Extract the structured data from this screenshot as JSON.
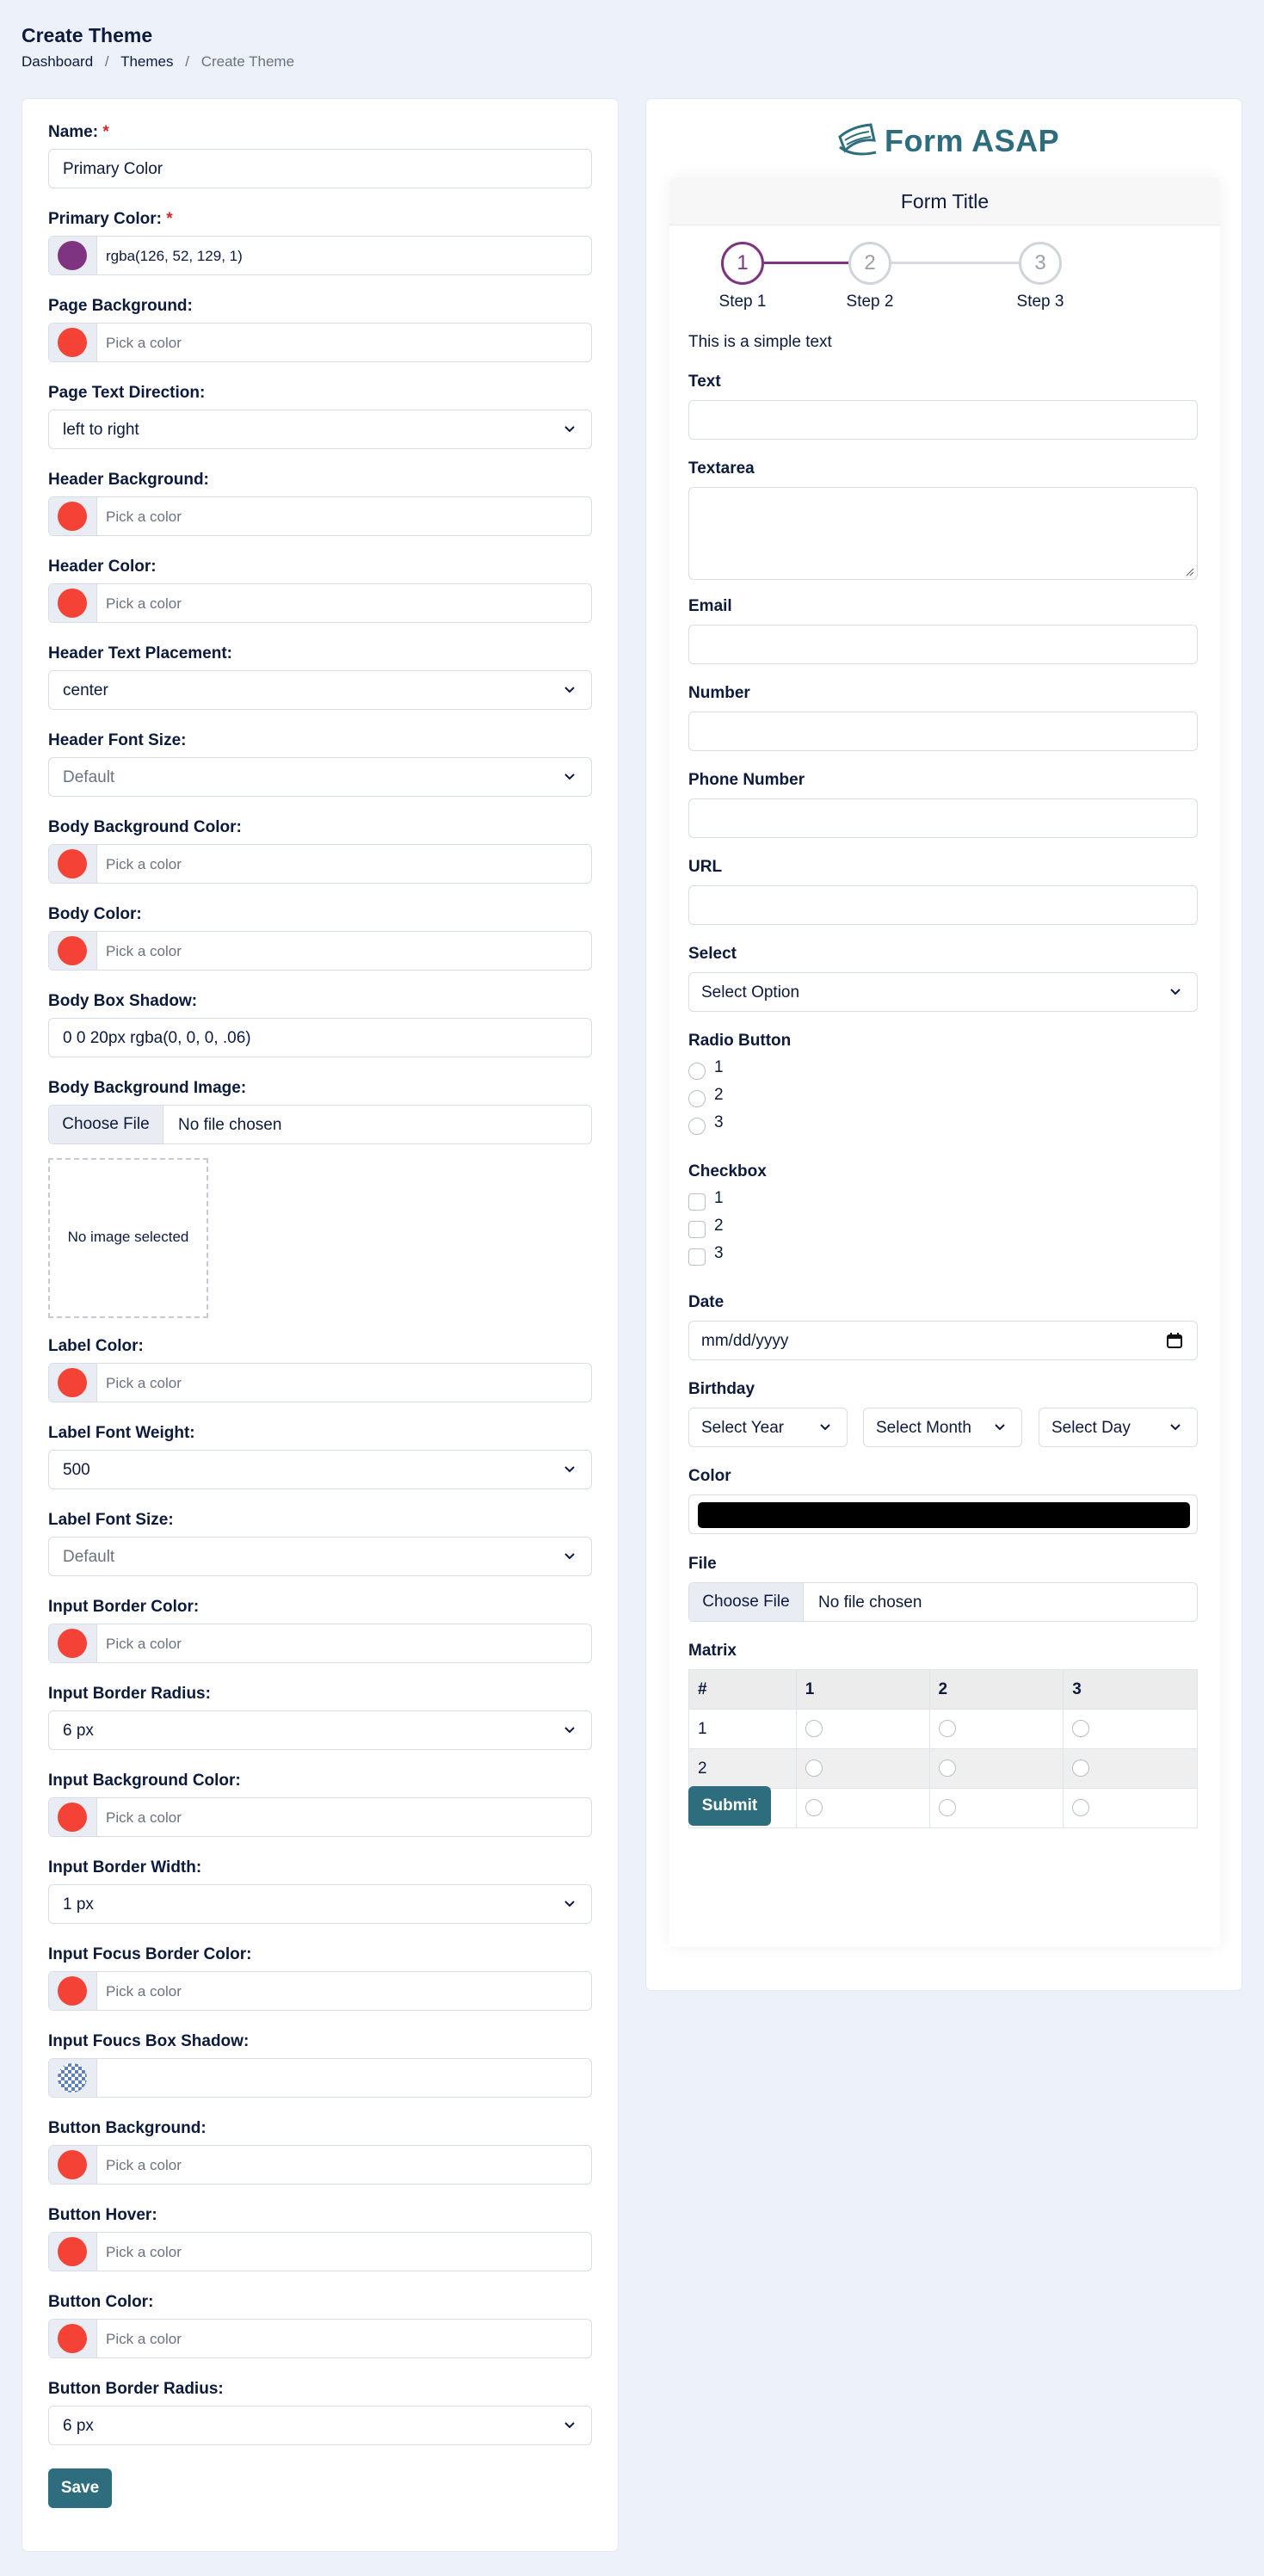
{
  "header": {
    "title": "Create Theme",
    "breadcrumb": [
      "Dashboard",
      "Themes",
      "Create Theme"
    ],
    "separator": "/"
  },
  "theme_form": {
    "name": {
      "label": "Name:",
      "required_mark": "*",
      "value": "Primary Color"
    },
    "primary_color": {
      "label": "Primary Color:",
      "required_mark": "*",
      "value": "rgba(126, 52, 129, 1)",
      "swatch": "#7e3481"
    },
    "page_background": {
      "label": "Page Background:",
      "placeholder": "Pick a color",
      "swatch": "#f44336"
    },
    "page_text_direction": {
      "label": "Page Text Direction:",
      "value": "left to right"
    },
    "header_background": {
      "label": "Header Background:",
      "placeholder": "Pick a color",
      "swatch": "#f44336"
    },
    "header_color": {
      "label": "Header Color:",
      "placeholder": "Pick a color",
      "swatch": "#f44336"
    },
    "header_text_placement": {
      "label": "Header Text Placement:",
      "value": "center"
    },
    "header_font_size": {
      "label": "Header Font Size:",
      "value": "Default"
    },
    "body_background_color": {
      "label": "Body Background Color:",
      "placeholder": "Pick a color",
      "swatch": "#f44336"
    },
    "body_color": {
      "label": "Body Color:",
      "placeholder": "Pick a color",
      "swatch": "#f44336"
    },
    "body_box_shadow": {
      "label": "Body Box Shadow:",
      "value": "0 0 20px rgba(0, 0, 0, .06)"
    },
    "body_background_image": {
      "label": "Body Background Image:",
      "button": "Choose File",
      "status": "No file chosen",
      "preview_text": "No image selected"
    },
    "label_color": {
      "label": "Label Color:",
      "placeholder": "Pick a color",
      "swatch": "#f44336"
    },
    "label_font_weight": {
      "label": "Label Font Weight:",
      "value": "500"
    },
    "label_font_size": {
      "label": "Label Font Size:",
      "value": "Default"
    },
    "input_border_color": {
      "label": "Input Border Color:",
      "placeholder": "Pick a color",
      "swatch": "#f44336"
    },
    "input_border_radius": {
      "label": "Input Border Radius:",
      "value": "6 px"
    },
    "input_background_color": {
      "label": "Input Background Color:",
      "placeholder": "Pick a color",
      "swatch": "#f44336"
    },
    "input_border_width": {
      "label": "Input Border Width:",
      "value": "1 px"
    },
    "input_focus_border_color": {
      "label": "Input Focus Border Color:",
      "placeholder": "Pick a color",
      "swatch": "#f44336"
    },
    "input_focus_box_shadow": {
      "label": "Input Foucs Box Shadow:",
      "value": ""
    },
    "button_background": {
      "label": "Button Background:",
      "placeholder": "Pick a color",
      "swatch": "#f44336"
    },
    "button_hover": {
      "label": "Button Hover:",
      "placeholder": "Pick a color",
      "swatch": "#f44336"
    },
    "button_color": {
      "label": "Button Color:",
      "placeholder": "Pick a color",
      "swatch": "#f44336"
    },
    "button_border_radius": {
      "label": "Button Border Radius:",
      "value": "6 px"
    },
    "save_label": "Save"
  },
  "preview": {
    "logo_text": "Form ASAP",
    "form_title": "Form Title",
    "steps": [
      {
        "number": "1",
        "label": "Step 1"
      },
      {
        "number": "2",
        "label": "Step 2"
      },
      {
        "number": "3",
        "label": "Step 3"
      }
    ],
    "simple_text": "This is a simple text",
    "text_label": "Text",
    "textarea_label": "Textarea",
    "email_label": "Email",
    "number_label": "Number",
    "phone_label": "Phone Number",
    "url_label": "URL",
    "select_label": "Select",
    "select_placeholder": "Select Option",
    "radio_label": "Radio Button",
    "radio_options": [
      "1",
      "2",
      "3"
    ],
    "checkbox_label": "Checkbox",
    "checkbox_options": [
      "1",
      "2",
      "3"
    ],
    "date_label": "Date",
    "date_placeholder": "mm/dd/yyyy",
    "birthday_label": "Birthday",
    "birthday_year": "Select Year",
    "birthday_month": "Select Month",
    "birthday_day": "Select Day",
    "color_label": "Color",
    "color_value": "#000000",
    "file_label": "File",
    "file_button": "Choose File",
    "file_status": "No file chosen",
    "matrix_label": "Matrix",
    "matrix_headers": [
      "#",
      "1",
      "2",
      "3"
    ],
    "matrix_rows": [
      "1",
      "2",
      "3"
    ],
    "submit_label": "Submit"
  },
  "colors": {
    "accent": "#2d6d7e",
    "primary": "#7e3481",
    "swatch_red": "#f44336",
    "page_bg": "#edf1f9"
  }
}
